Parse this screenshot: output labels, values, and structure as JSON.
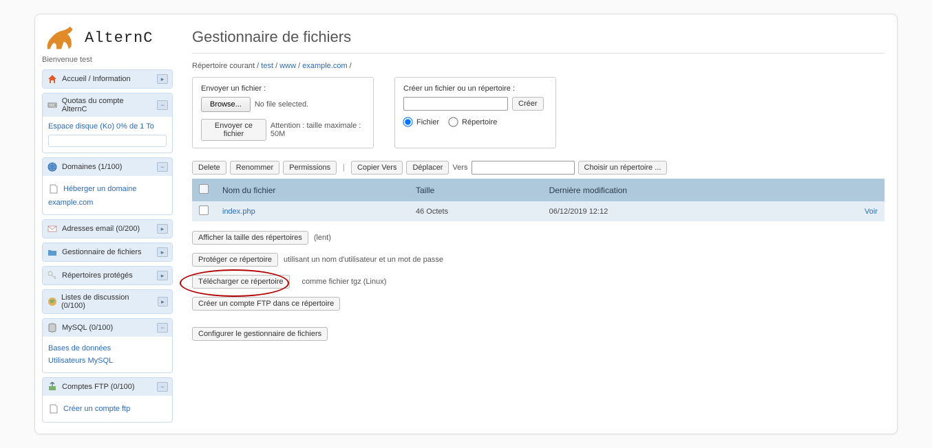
{
  "sidebar": {
    "logo_text": "AlternC",
    "welcome": "Bienvenue test",
    "panels": {
      "home": {
        "title": "Accueil / Information"
      },
      "quota": {
        "title": "Quotas du compte AlternC",
        "line": "Espace disque (Ko) 0% de 1 To"
      },
      "domains": {
        "title": "Domaines (1/100)",
        "host_label": "Héberger un domaine",
        "domain_link": "example.com"
      },
      "emails": {
        "title": "Adresses email (0/200)"
      },
      "files": {
        "title": "Gestionnaire de fichiers"
      },
      "protected": {
        "title": "Répertoires protégés"
      },
      "lists": {
        "title": "Listes de discussion (0/100)"
      },
      "mysql": {
        "title": "MySQL (0/100)",
        "db_label": "Bases de données",
        "users_label": "Utilisateurs MySQL"
      },
      "ftp": {
        "title": "Comptes FTP (0/100)",
        "create_label": "Créer un compte ftp"
      }
    }
  },
  "main": {
    "title": "Gestionnaire de fichiers",
    "breadcrumb": {
      "label": "Répertoire courant",
      "parts": [
        "test",
        "www",
        "example.com"
      ]
    },
    "upload": {
      "label": "Envoyer un fichier :",
      "browse": "Browse...",
      "nofile": "No file selected.",
      "submit": "Envoyer ce fichier",
      "note": "Attention : taille maximale : 50M"
    },
    "create": {
      "label": "Créer un fichier ou un répertoire :",
      "submit": "Créer",
      "opt_file": "Fichier",
      "opt_dir": "Répertoire"
    },
    "toolbar": {
      "delete": "Delete",
      "rename": "Renommer",
      "perms": "Permissions",
      "copy": "Copier Vers",
      "move": "Déplacer",
      "to": "Vers",
      "choose": "Choisir un répertoire ..."
    },
    "table": {
      "col_name": "Nom du fichier",
      "col_size": "Taille",
      "col_mod": "Dernière modification",
      "rows": [
        {
          "name": "index.php",
          "size": "46 Octets",
          "mod": "06/12/2019 12:12",
          "view": "Voir"
        }
      ]
    },
    "actions": {
      "showsize": "Afficher la taille des répertoires",
      "slow": "(lent)",
      "protect": "Protéger ce répertoire",
      "protect_note": "utilisant un nom d'utilisateur et un mot de passe",
      "download": "Télécharger ce répertoire",
      "download_note": "comme fichier tgz (Linux)",
      "ftp": "Créer un compte FTP dans ce répertoire",
      "configure": "Configurer le gestionnaire de fichiers"
    }
  }
}
